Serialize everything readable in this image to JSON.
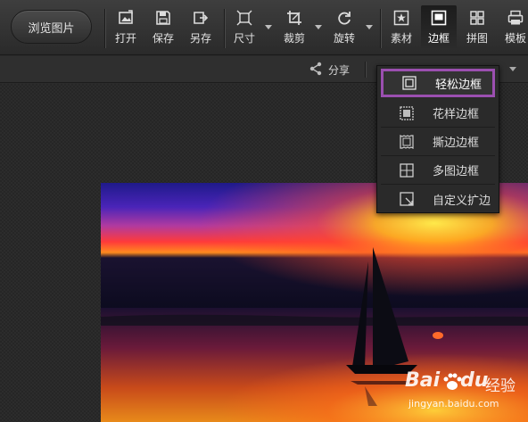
{
  "browse_button": {
    "label": "浏览图片"
  },
  "toolbar": {
    "tools": [
      {
        "id": "open",
        "label": "打开",
        "icon": "open-image-icon"
      },
      {
        "id": "save",
        "label": "保存",
        "icon": "save-icon"
      },
      {
        "id": "save_as",
        "label": "另存",
        "icon": "save-as-icon"
      },
      {
        "id": "size",
        "label": "尺寸",
        "icon": "resize-icon",
        "has_dropdown": true
      },
      {
        "id": "crop",
        "label": "裁剪",
        "icon": "crop-icon",
        "has_dropdown": true
      },
      {
        "id": "rotate",
        "label": "旋转",
        "icon": "rotate-icon",
        "has_dropdown": true
      },
      {
        "id": "material",
        "label": "素材",
        "icon": "star-icon"
      },
      {
        "id": "border",
        "label": "边框",
        "icon": "border-icon",
        "active": true
      },
      {
        "id": "collage",
        "label": "拼图",
        "icon": "grid-icon"
      },
      {
        "id": "template",
        "label": "模板",
        "icon": "printer-icon"
      }
    ]
  },
  "subbar": {
    "share_label": "分享"
  },
  "border_menu": {
    "items": [
      {
        "label": "轻松边框",
        "icon": "simple-border-icon",
        "highlighted": true
      },
      {
        "label": "花样边框",
        "icon": "pattern-border-icon"
      },
      {
        "label": "撕边边框",
        "icon": "torn-border-icon"
      },
      {
        "label": "多图边框",
        "icon": "multi-image-border-icon"
      },
      {
        "label": "自定义扩边",
        "icon": "custom-extend-icon"
      }
    ]
  },
  "watermark": {
    "brand": "Bai",
    "brand_suffix": "du",
    "cn": "经验",
    "url": "jingyan.baidu.com"
  },
  "colors": {
    "highlight_border": "#9b4fb0",
    "toolbar_bg": "#333333"
  }
}
